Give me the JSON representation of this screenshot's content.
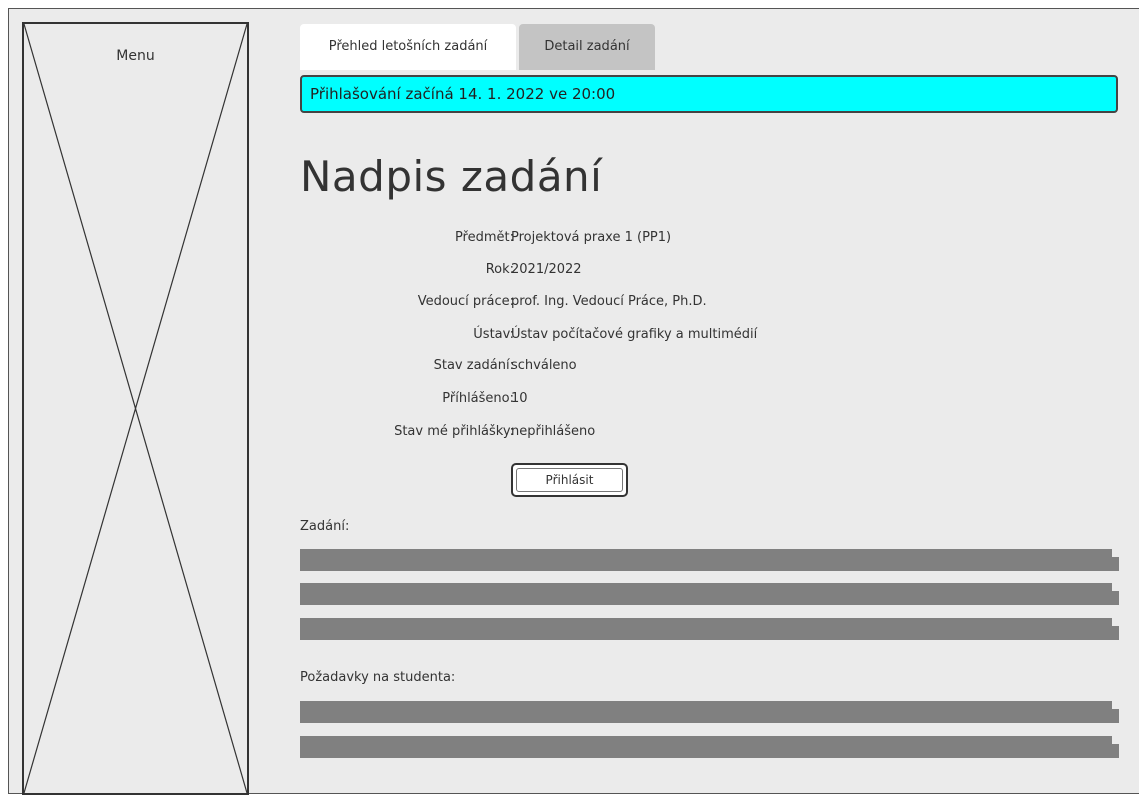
{
  "menu": {
    "label": "Menu"
  },
  "tabs": [
    {
      "label": "Přehled letošních zadání",
      "active": true
    },
    {
      "label": "Detail zadání",
      "active": false
    }
  ],
  "banner": {
    "text": "Přihlašování začíná 14. 1. 2022 ve 20:00",
    "color": "#00ffff"
  },
  "title": "Nadpis zadání",
  "details": [
    {
      "label": "Předmět:",
      "value": "Projektová praxe 1 (PP1)"
    },
    {
      "label": "Rok:",
      "value": "2021/2022"
    },
    {
      "label": "Vedoucí práce:",
      "value": "prof. Ing. Vedoucí Práce, Ph.D."
    },
    {
      "label": "Ústav:",
      "value": "Ústav počítačové grafiky a multimédií"
    },
    {
      "label": "Stav zadání:",
      "value": "schváleno"
    },
    {
      "label": "Příhlášeno:",
      "value": "10"
    },
    {
      "label": "Stav mé přihlášky:",
      "value": "nepřihlášeno"
    }
  ],
  "signup_button": {
    "label": "Přihlásit"
  },
  "sections": {
    "assignment_label": "Zadání:",
    "requirements_label": "Požadavky na studenta:"
  },
  "colors": {
    "background": "#ebebeb",
    "placeholder_bar": "#808080",
    "active_tab": "#ffffff",
    "inactive_tab": "#c4c4c4"
  }
}
